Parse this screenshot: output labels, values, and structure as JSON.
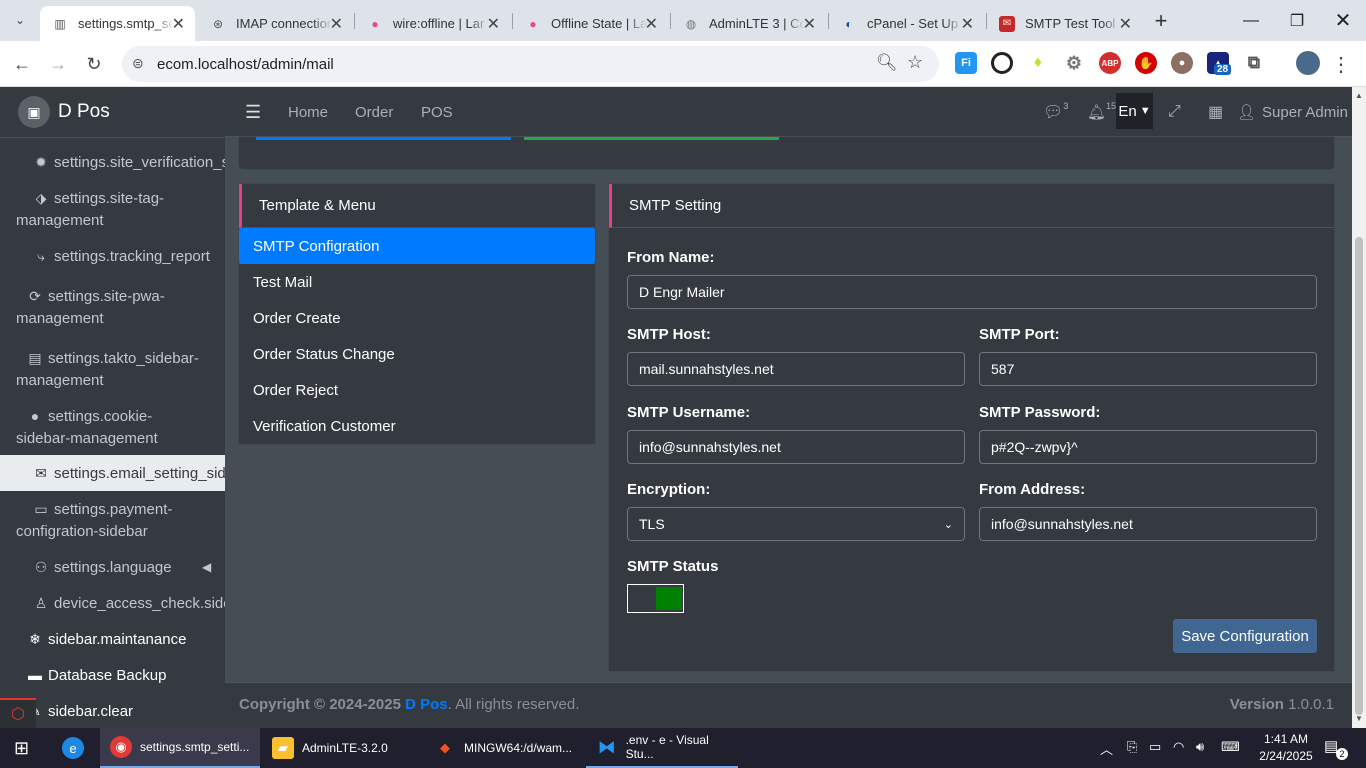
{
  "browser": {
    "tabs": [
      {
        "title": "settings.smtp_se",
        "active": true
      },
      {
        "title": "IMAP connection"
      },
      {
        "title": "wire:offline | Lar"
      },
      {
        "title": "Offline State | La"
      },
      {
        "title": "AdminLTE 3 | Co"
      },
      {
        "title": "cPanel - Set Up"
      },
      {
        "title": "SMTP Test Tool"
      }
    ],
    "url": "ecom.localhost/admin/mail",
    "ext_badge": "28"
  },
  "sidebar": {
    "brand": "D Pos",
    "items": [
      {
        "label": "settings.site_verification_si",
        "icon": "gear-icon"
      },
      {
        "label": "settings.site-tag-management",
        "icon": "tags-icon"
      },
      {
        "label": "settings.tracking_report",
        "icon": "route-icon"
      },
      {
        "label": "settings.site-pwa-management",
        "icon": "pwa-icon"
      },
      {
        "label": "settings.takto_sidebar-management",
        "icon": "chat-icon"
      },
      {
        "label": "settings.cookie-sidebar-management",
        "icon": "cookie-icon"
      },
      {
        "label": "settings.email_setting_side",
        "icon": "envelope-icon",
        "active": true
      },
      {
        "label": "settings.payment-configration-sidebar",
        "icon": "card-icon"
      },
      {
        "label": "settings.language",
        "icon": "user-cog-icon"
      },
      {
        "label": "device_access_check.sideb",
        "icon": "user-shield-icon"
      },
      {
        "label": "sidebar.maintanance",
        "icon": "snowflake-icon"
      },
      {
        "label": "Database Backup",
        "icon": "hdd-icon"
      },
      {
        "label": "sidebar.clear",
        "icon": "broom-icon"
      }
    ]
  },
  "navbar": {
    "links": [
      "Home",
      "Order",
      "POS"
    ],
    "messages_count": "3",
    "notifications_count": "15",
    "language": "En",
    "user": "Super Admin"
  },
  "template_menu": {
    "title": "Template & Menu",
    "items": [
      "SMTP Configration",
      "Test Mail",
      "Order Create",
      "Order Status Change",
      "Order Reject",
      "Verification Customer"
    ]
  },
  "smtp": {
    "title": "SMTP Setting",
    "from_name_label": "From Name:",
    "from_name": "D Engr Mailer",
    "host_label": "SMTP Host:",
    "host": "mail.sunnahstyles.net",
    "port_label": "SMTP Port:",
    "port": "587",
    "username_label": "SMTP Username:",
    "username": "info@sunnahstyles.net",
    "password_label": "SMTP Password:",
    "password": "p#2Q--zwpv}^",
    "encryption_label": "Encryption:",
    "encryption": "TLS",
    "from_address_label": "From Address:",
    "from_address": "info@sunnahstyles.net",
    "status_label": "SMTP Status",
    "status_enabled": true,
    "save_label": "Save Configuration"
  },
  "footer": {
    "copyright": "Copyright © 2024-2025",
    "brand": "D Pos",
    "rights": ". All rights reserved.",
    "version_label": "Version",
    "version": "1.0.0.1"
  },
  "taskbar": {
    "apps": [
      "settings.smtp_setti...",
      "AdminLTE-3.2.0",
      "MINGW64:/d/wam...",
      ".env - e - Visual Stu..."
    ],
    "time": "1:41 AM",
    "date": "2/24/2025",
    "notification_count": "2"
  },
  "colors": {
    "accent": "#007bff",
    "card_border": "#e83e8c",
    "save_button": "#3f6791",
    "toggle_on": "#008000"
  }
}
